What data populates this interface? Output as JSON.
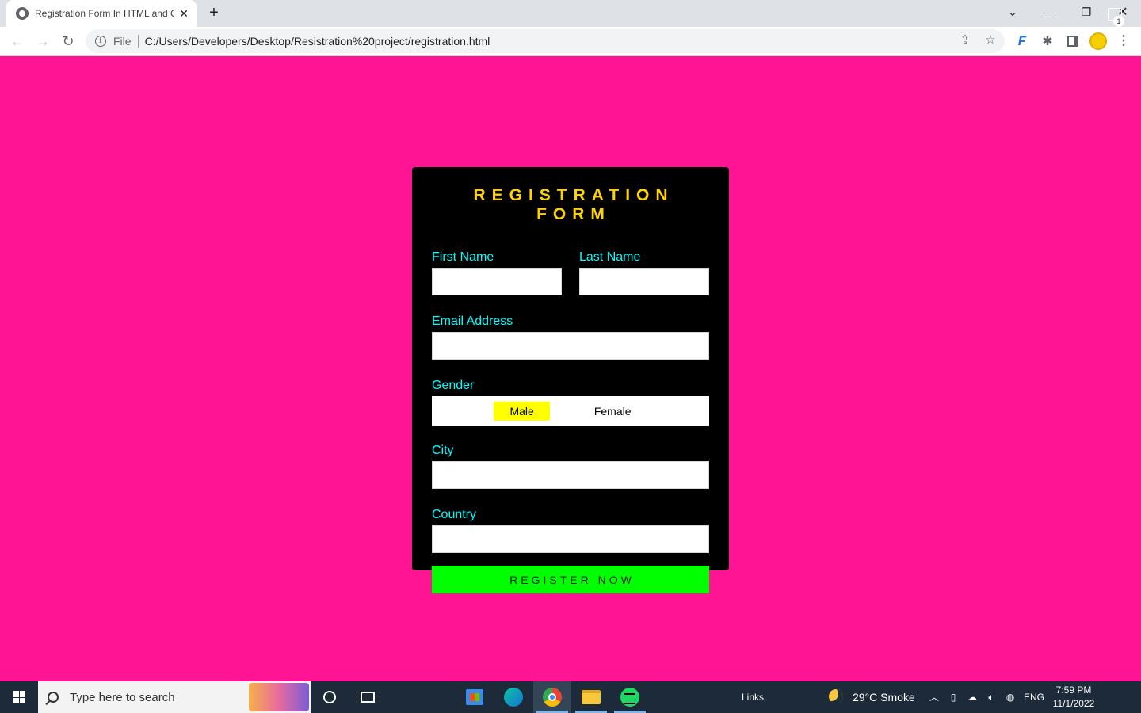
{
  "browser": {
    "tab_title": "Registration Form In HTML and CSS",
    "tab_close": "✕",
    "new_tab": "+",
    "address_scheme": "File",
    "address_url": "C:/Users/Developers/Desktop/Resistration%20project/registration.html"
  },
  "form": {
    "title": "REGISTRATION FORM",
    "first_name_label": "First Name",
    "last_name_label": "Last Name",
    "email_label": "Email Address",
    "gender_label": "Gender",
    "gender_options": [
      "Male",
      "Female"
    ],
    "gender_selected": "Male",
    "city_label": "City",
    "country_label": "Country",
    "submit_label": "REGISTER NOW",
    "accent_colors": {
      "page_background": "#ff1493",
      "title": "#ffd300",
      "labels": "#00ffff",
      "selected_gender": "#ffff00",
      "submit_button": "#00ff00"
    }
  },
  "taskbar": {
    "search_placeholder": "Type here to search",
    "links_label": "Links",
    "weather": "29°C  Smoke",
    "language": "ENG",
    "time": "7:59 PM",
    "date": "11/1/2022",
    "notification_count": "1",
    "pinned_apps": [
      "microsoft-store-icon",
      "edge-icon",
      "chrome-icon",
      "file-explorer-icon",
      "spotify-icon"
    ]
  }
}
